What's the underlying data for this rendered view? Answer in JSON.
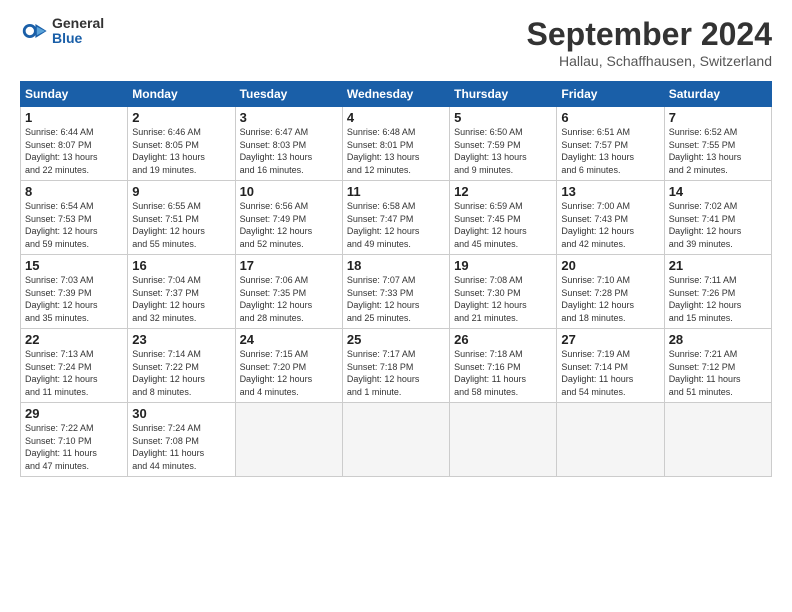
{
  "header": {
    "logo_general": "General",
    "logo_blue": "Blue",
    "title": "September 2024",
    "location": "Hallau, Schaffhausen, Switzerland"
  },
  "weekdays": [
    "Sunday",
    "Monday",
    "Tuesday",
    "Wednesday",
    "Thursday",
    "Friday",
    "Saturday"
  ],
  "weeks": [
    [
      {
        "day": "1",
        "info": "Sunrise: 6:44 AM\nSunset: 8:07 PM\nDaylight: 13 hours\nand 22 minutes."
      },
      {
        "day": "2",
        "info": "Sunrise: 6:46 AM\nSunset: 8:05 PM\nDaylight: 13 hours\nand 19 minutes."
      },
      {
        "day": "3",
        "info": "Sunrise: 6:47 AM\nSunset: 8:03 PM\nDaylight: 13 hours\nand 16 minutes."
      },
      {
        "day": "4",
        "info": "Sunrise: 6:48 AM\nSunset: 8:01 PM\nDaylight: 13 hours\nand 12 minutes."
      },
      {
        "day": "5",
        "info": "Sunrise: 6:50 AM\nSunset: 7:59 PM\nDaylight: 13 hours\nand 9 minutes."
      },
      {
        "day": "6",
        "info": "Sunrise: 6:51 AM\nSunset: 7:57 PM\nDaylight: 13 hours\nand 6 minutes."
      },
      {
        "day": "7",
        "info": "Sunrise: 6:52 AM\nSunset: 7:55 PM\nDaylight: 13 hours\nand 2 minutes."
      }
    ],
    [
      {
        "day": "8",
        "info": "Sunrise: 6:54 AM\nSunset: 7:53 PM\nDaylight: 12 hours\nand 59 minutes."
      },
      {
        "day": "9",
        "info": "Sunrise: 6:55 AM\nSunset: 7:51 PM\nDaylight: 12 hours\nand 55 minutes."
      },
      {
        "day": "10",
        "info": "Sunrise: 6:56 AM\nSunset: 7:49 PM\nDaylight: 12 hours\nand 52 minutes."
      },
      {
        "day": "11",
        "info": "Sunrise: 6:58 AM\nSunset: 7:47 PM\nDaylight: 12 hours\nand 49 minutes."
      },
      {
        "day": "12",
        "info": "Sunrise: 6:59 AM\nSunset: 7:45 PM\nDaylight: 12 hours\nand 45 minutes."
      },
      {
        "day": "13",
        "info": "Sunrise: 7:00 AM\nSunset: 7:43 PM\nDaylight: 12 hours\nand 42 minutes."
      },
      {
        "day": "14",
        "info": "Sunrise: 7:02 AM\nSunset: 7:41 PM\nDaylight: 12 hours\nand 39 minutes."
      }
    ],
    [
      {
        "day": "15",
        "info": "Sunrise: 7:03 AM\nSunset: 7:39 PM\nDaylight: 12 hours\nand 35 minutes."
      },
      {
        "day": "16",
        "info": "Sunrise: 7:04 AM\nSunset: 7:37 PM\nDaylight: 12 hours\nand 32 minutes."
      },
      {
        "day": "17",
        "info": "Sunrise: 7:06 AM\nSunset: 7:35 PM\nDaylight: 12 hours\nand 28 minutes."
      },
      {
        "day": "18",
        "info": "Sunrise: 7:07 AM\nSunset: 7:33 PM\nDaylight: 12 hours\nand 25 minutes."
      },
      {
        "day": "19",
        "info": "Sunrise: 7:08 AM\nSunset: 7:30 PM\nDaylight: 12 hours\nand 21 minutes."
      },
      {
        "day": "20",
        "info": "Sunrise: 7:10 AM\nSunset: 7:28 PM\nDaylight: 12 hours\nand 18 minutes."
      },
      {
        "day": "21",
        "info": "Sunrise: 7:11 AM\nSunset: 7:26 PM\nDaylight: 12 hours\nand 15 minutes."
      }
    ],
    [
      {
        "day": "22",
        "info": "Sunrise: 7:13 AM\nSunset: 7:24 PM\nDaylight: 12 hours\nand 11 minutes."
      },
      {
        "day": "23",
        "info": "Sunrise: 7:14 AM\nSunset: 7:22 PM\nDaylight: 12 hours\nand 8 minutes."
      },
      {
        "day": "24",
        "info": "Sunrise: 7:15 AM\nSunset: 7:20 PM\nDaylight: 12 hours\nand 4 minutes."
      },
      {
        "day": "25",
        "info": "Sunrise: 7:17 AM\nSunset: 7:18 PM\nDaylight: 12 hours\nand 1 minute."
      },
      {
        "day": "26",
        "info": "Sunrise: 7:18 AM\nSunset: 7:16 PM\nDaylight: 11 hours\nand 58 minutes."
      },
      {
        "day": "27",
        "info": "Sunrise: 7:19 AM\nSunset: 7:14 PM\nDaylight: 11 hours\nand 54 minutes."
      },
      {
        "day": "28",
        "info": "Sunrise: 7:21 AM\nSunset: 7:12 PM\nDaylight: 11 hours\nand 51 minutes."
      }
    ],
    [
      {
        "day": "29",
        "info": "Sunrise: 7:22 AM\nSunset: 7:10 PM\nDaylight: 11 hours\nand 47 minutes."
      },
      {
        "day": "30",
        "info": "Sunrise: 7:24 AM\nSunset: 7:08 PM\nDaylight: 11 hours\nand 44 minutes."
      },
      {
        "day": "",
        "info": ""
      },
      {
        "day": "",
        "info": ""
      },
      {
        "day": "",
        "info": ""
      },
      {
        "day": "",
        "info": ""
      },
      {
        "day": "",
        "info": ""
      }
    ]
  ]
}
